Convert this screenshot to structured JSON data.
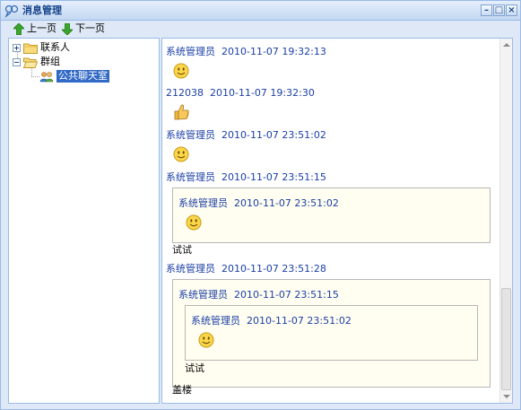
{
  "window": {
    "title": "消息管理",
    "controls": {
      "minimize": "–",
      "maximize": "□",
      "close": "×"
    }
  },
  "toolbar": {
    "prev_label": "上一页",
    "next_label": "下一页"
  },
  "tree": {
    "nodes": [
      {
        "label": "联系人",
        "expanded": false
      },
      {
        "label": "群组",
        "expanded": true
      },
      {
        "label": "公共聊天室",
        "selected": true
      }
    ]
  },
  "messages": [
    {
      "sender": "系统管理员",
      "time": "2010-11-07 19:32:13",
      "content": "smiley"
    },
    {
      "sender": "212038",
      "time": "2010-11-07 19:32:30",
      "content": "thumbs-up"
    },
    {
      "sender": "系统管理员",
      "time": "2010-11-07 23:51:02",
      "content": "smiley"
    },
    {
      "sender": "系统管理员",
      "time": "2010-11-07 23:51:15",
      "quote": {
        "sender": "系统管理员",
        "time": "2010-11-07 23:51:02",
        "content": "smiley"
      },
      "text": "试试"
    },
    {
      "sender": "系统管理员",
      "time": "2010-11-07 23:51:28",
      "quote": {
        "sender": "系统管理员",
        "time": "2010-11-07 23:51:15",
        "quote": {
          "sender": "系统管理员",
          "time": "2010-11-07 23:51:02",
          "content": "smiley"
        },
        "text": "试试"
      },
      "text": "盖楼"
    }
  ],
  "colors": {
    "accent": "#15428b",
    "sender": "#1b3fa6",
    "quote_bg": "#fffef0",
    "selection": "#3169c6"
  }
}
